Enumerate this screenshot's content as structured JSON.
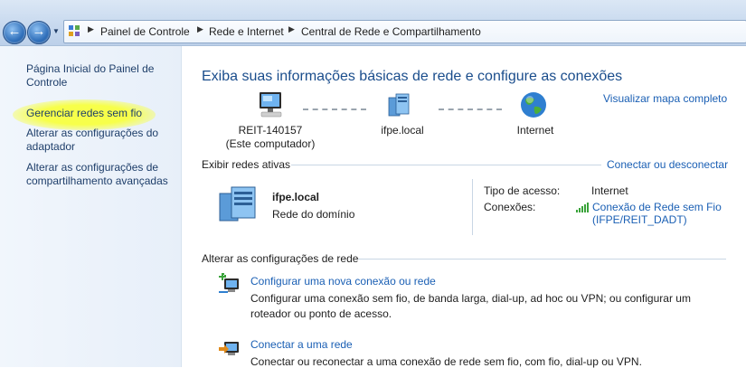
{
  "breadcrumb": [
    "Painel de Controle",
    "Rede e Internet",
    "Central de Rede e Compartilhamento"
  ],
  "sidebar": {
    "items": [
      {
        "label_line1": "Página Inicial do Painel de",
        "label_line2": "Controle"
      },
      {
        "label_line1": "Gerenciar redes sem fio",
        "label_line2": ""
      },
      {
        "label_line1": "Alterar as configurações do",
        "label_line2": "adaptador"
      },
      {
        "label_line1": "Alterar as configurações de",
        "label_line2": "compartilhamento avançadas"
      }
    ],
    "highlight_color": "#f7ff4a"
  },
  "main": {
    "title": "Exiba suas informações básicas de rede e configure as conexões",
    "map_link": "Visualizar mapa completo",
    "nodes": [
      {
        "name": "REIT-140157",
        "sub": "(Este computador)",
        "icon": "computer-icon"
      },
      {
        "name": "ifpe.local",
        "sub": "",
        "icon": "domain-network-icon"
      },
      {
        "name": "Internet",
        "sub": "",
        "icon": "globe-icon"
      }
    ],
    "active_networks": {
      "heading": "Exibir redes ativas",
      "connect_link": "Conectar ou desconectar",
      "network_name": "ifpe.local",
      "network_type": "Rede do domínio",
      "access_type_label": "Tipo de acesso:",
      "access_type_value": "Internet",
      "connections_label": "Conexões:",
      "connection_line1": "Conexão de Rede sem Fio",
      "connection_line2": "(IFPE/REIT_DADT)"
    },
    "settings": {
      "heading": "Alterar as configurações de rede",
      "tasks": [
        {
          "title": "Configurar uma nova conexão ou rede",
          "desc_line1": "Configurar uma conexão sem fio, de banda larga, dial-up, ad hoc ou VPN; ou configurar um",
          "desc_line2": "roteador ou ponto de acesso."
        },
        {
          "title": "Conectar a uma rede",
          "desc_line1": "Conectar ou reconectar a uma conexão de rede sem fio, com fio, dial-up ou VPN.",
          "desc_line2": ""
        }
      ]
    }
  },
  "colors": {
    "link": "#1a5fb4",
    "title": "#1a4d8c",
    "sidebar_link": "#1e3e6a"
  }
}
